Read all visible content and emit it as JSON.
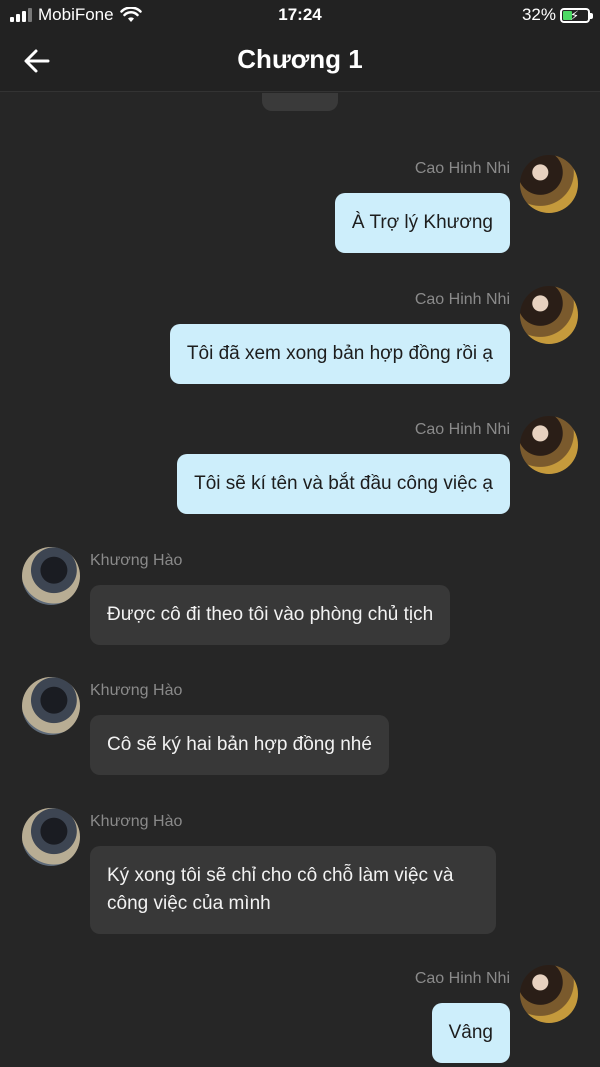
{
  "status": {
    "carrier": "MobiFone",
    "time": "17:24",
    "battery": "32%"
  },
  "header": {
    "title": "Chương 1"
  },
  "messages": [
    {
      "sender": "Cao Hinh Nhi",
      "text": "À Trợ lý Khương",
      "side": "right"
    },
    {
      "sender": "Cao Hinh Nhi",
      "text": "Tôi đã xem xong bản hợp đồng rồi ạ",
      "side": "right"
    },
    {
      "sender": "Cao Hinh Nhi",
      "text": "Tôi sẽ kí tên và bắt đầu công việc ạ",
      "side": "right"
    },
    {
      "sender": "Khương Hào",
      "text": "Được cô đi theo tôi vào phòng chủ tịch",
      "side": "left"
    },
    {
      "sender": "Khương Hào",
      "text": "Cô sẽ ký hai bản hợp đồng nhé",
      "side": "left"
    },
    {
      "sender": "Khương Hào",
      "text": "Ký xong tôi sẽ chỉ cho cô chỗ làm việc và công việc của mình",
      "side": "left"
    },
    {
      "sender": "Cao Hinh Nhi",
      "text": "Vâng",
      "side": "right"
    }
  ]
}
